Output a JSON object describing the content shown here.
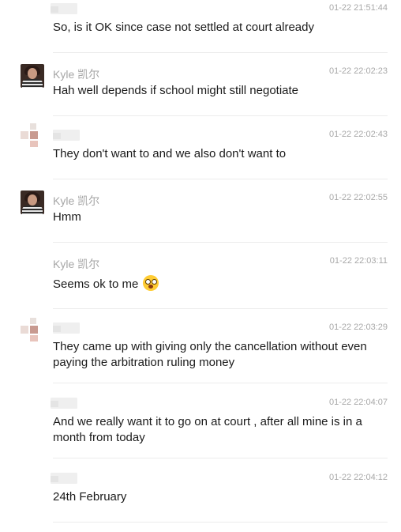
{
  "messages": [
    {
      "name": "",
      "time": "01-22 21:51:44",
      "text": "So, is it OK since case not settled at court already"
    },
    {
      "name": "Kyle 凯尔",
      "time": "01-22 22:02:23",
      "text": "Hah well depends if school might still negotiate"
    },
    {
      "name": "",
      "time": "01-22 22:02:43",
      "text": "They don't want to and we also don't want to"
    },
    {
      "name": "Kyle 凯尔",
      "time": "01-22 22:02:55",
      "text": "Hmm"
    },
    {
      "name": "Kyle 凯尔",
      "time": "01-22 22:03:11",
      "text": "Seems ok to me"
    },
    {
      "name": "",
      "time": "01-22 22:03:29",
      "text": "They came up with giving only the cancellation without even paying the arbitration ruling money"
    },
    {
      "name": "",
      "time": "01-22 22:04:07",
      "text": "And we really want it to go on at court , after all mine is in a month from today"
    },
    {
      "name": "",
      "time": "01-22 22:04:12",
      "text": "24th February"
    }
  ],
  "icons": {
    "emoji": "flushed-face-emoji",
    "avatar_kyle": "user-photo-avatar",
    "avatar_other": "blurred-avatar"
  }
}
